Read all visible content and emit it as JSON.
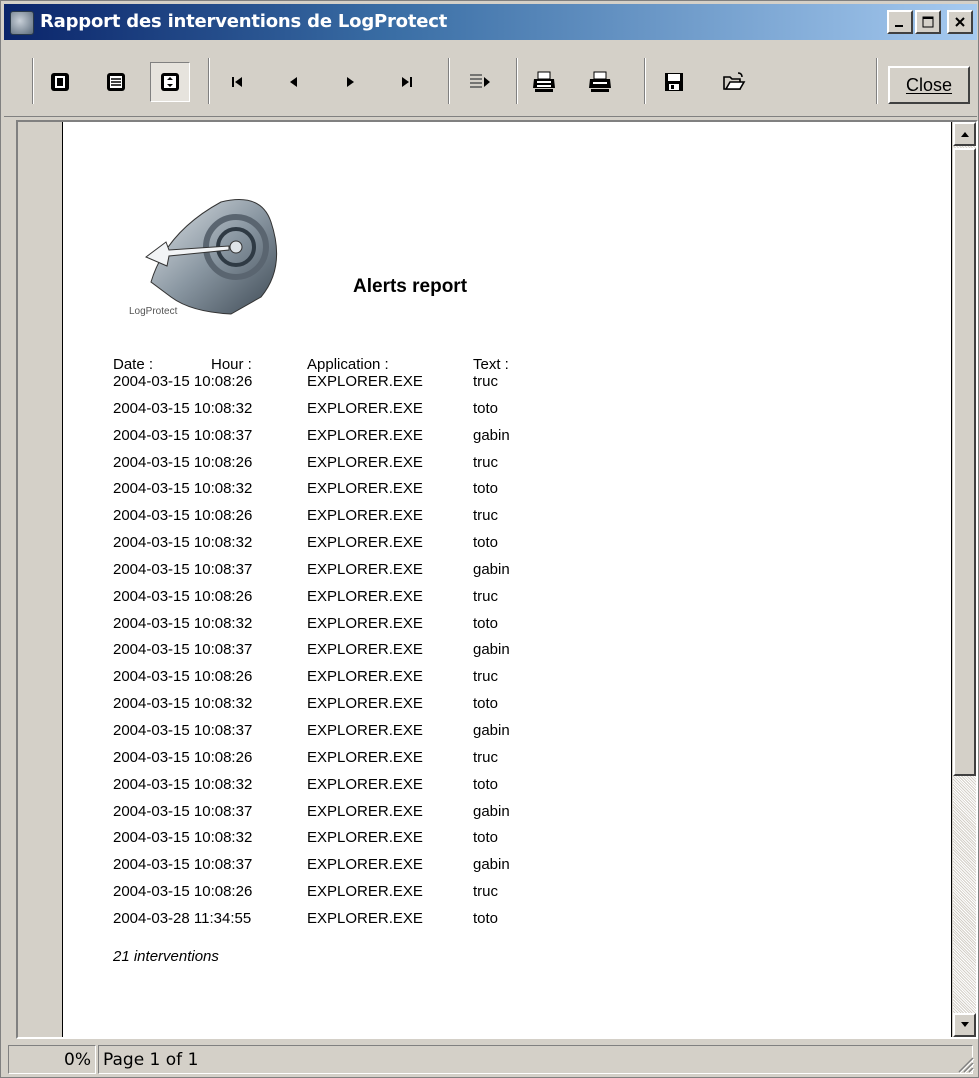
{
  "window": {
    "title": "Rapport des interventions de LogProtect",
    "controls": [
      "minimize-icon",
      "maximize-icon",
      "close-icon"
    ]
  },
  "toolbar": {
    "icons": [
      "single-page-icon",
      "multi-page-icon",
      "fit-page-icon",
      "first-page-icon",
      "previous-page-icon",
      "next-page-icon",
      "last-page-icon",
      "go-to-page-icon",
      "print-setup-icon",
      "print-icon",
      "save-icon",
      "open-icon"
    ],
    "close_label": "Close"
  },
  "report": {
    "logo_text": "LogProtect",
    "title": "Alerts report",
    "headers": {
      "date": "Date :",
      "hour": "Hour :",
      "application": "Application :",
      "text": "Text :"
    },
    "rows": [
      {
        "datetime": "2004-03-15 10:08:26",
        "application": "EXPLORER.EXE",
        "text": "truc"
      },
      {
        "datetime": "2004-03-15 10:08:32",
        "application": "EXPLORER.EXE",
        "text": "toto"
      },
      {
        "datetime": "2004-03-15 10:08:37",
        "application": "EXPLORER.EXE",
        "text": "gabin"
      },
      {
        "datetime": "2004-03-15 10:08:26",
        "application": "EXPLORER.EXE",
        "text": "truc"
      },
      {
        "datetime": "2004-03-15 10:08:32",
        "application": "EXPLORER.EXE",
        "text": "toto"
      },
      {
        "datetime": "2004-03-15 10:08:26",
        "application": "EXPLORER.EXE",
        "text": "truc"
      },
      {
        "datetime": "2004-03-15 10:08:32",
        "application": "EXPLORER.EXE",
        "text": "toto"
      },
      {
        "datetime": "2004-03-15 10:08:37",
        "application": "EXPLORER.EXE",
        "text": "gabin"
      },
      {
        "datetime": "2004-03-15 10:08:26",
        "application": "EXPLORER.EXE",
        "text": "truc"
      },
      {
        "datetime": "2004-03-15 10:08:32",
        "application": "EXPLORER.EXE",
        "text": "toto"
      },
      {
        "datetime": "2004-03-15 10:08:37",
        "application": "EXPLORER.EXE",
        "text": "gabin"
      },
      {
        "datetime": "2004-03-15 10:08:26",
        "application": "EXPLORER.EXE",
        "text": "truc"
      },
      {
        "datetime": "2004-03-15 10:08:32",
        "application": "EXPLORER.EXE",
        "text": "toto"
      },
      {
        "datetime": "2004-03-15 10:08:37",
        "application": "EXPLORER.EXE",
        "text": "gabin"
      },
      {
        "datetime": "2004-03-15 10:08:26",
        "application": "EXPLORER.EXE",
        "text": "truc"
      },
      {
        "datetime": "2004-03-15 10:08:32",
        "application": "EXPLORER.EXE",
        "text": "toto"
      },
      {
        "datetime": "2004-03-15 10:08:37",
        "application": "EXPLORER.EXE",
        "text": "gabin"
      },
      {
        "datetime": "2004-03-15 10:08:32",
        "application": "EXPLORER.EXE",
        "text": "toto"
      },
      {
        "datetime": "2004-03-15 10:08:37",
        "application": "EXPLORER.EXE",
        "text": "gabin"
      },
      {
        "datetime": "2004-03-15 10:08:26",
        "application": "EXPLORER.EXE",
        "text": "truc"
      },
      {
        "datetime": "2004-03-28 11:34:55",
        "application": "EXPLORER.EXE",
        "text": "toto"
      }
    ],
    "footer": "21 interventions"
  },
  "status": {
    "progress": "0%",
    "page": "Page 1 of 1"
  },
  "colors": {
    "titlebar_start": "#0a246a",
    "titlebar_end": "#a6caf0",
    "face": "#d4d0c8"
  }
}
